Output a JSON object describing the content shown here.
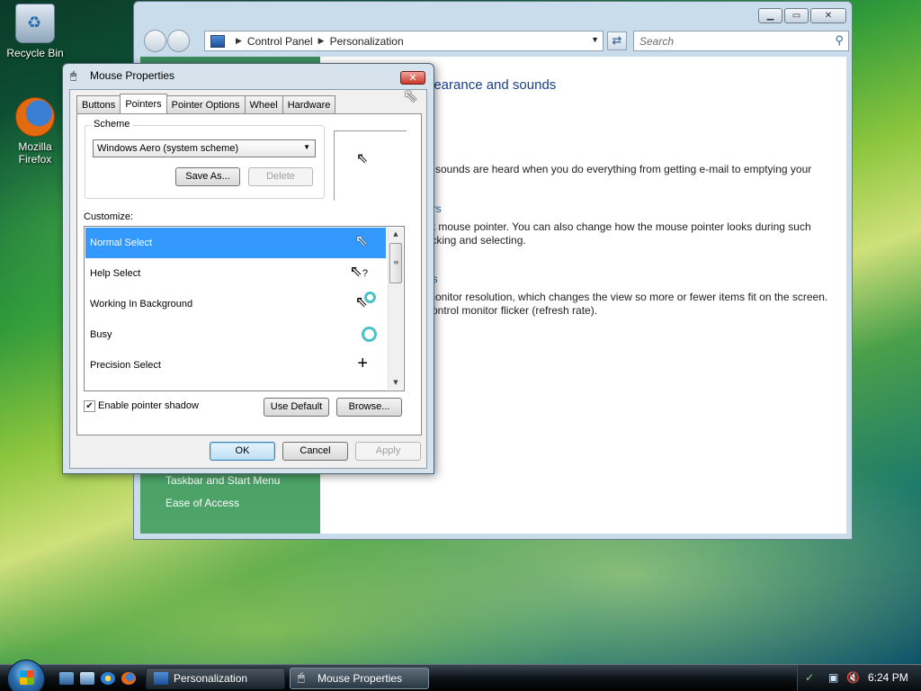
{
  "desktop": {
    "icons": [
      {
        "label": "Recycle Bin"
      },
      {
        "label": "Mozilla Firefox"
      }
    ]
  },
  "control_panel": {
    "address": {
      "segments": [
        "Control Panel",
        "Personalization"
      ]
    },
    "search_placeholder": "Search",
    "heading": "pearance and sounds",
    "lines": [
      "h sounds are heard when you do everything from getting e-mail to emptying your",
      "ers",
      "nt mouse pointer. You can also change how the mouse pointer looks during such",
      "licking and selecting.",
      "gs",
      "monitor resolution, which changes the view so more or fewer items fit on the screen.",
      "control monitor flicker (refresh rate)."
    ],
    "left_links": [
      "Taskbar and Start Menu",
      "Ease of Access"
    ]
  },
  "dialog": {
    "title": "Mouse Properties",
    "tabs": [
      "Buttons",
      "Pointers",
      "Pointer Options",
      "Wheel",
      "Hardware"
    ],
    "active_tab": "Pointers",
    "scheme_label": "Scheme",
    "scheme_value": "Windows Aero (system scheme)",
    "save_as": "Save As...",
    "delete": "Delete",
    "customize_label": "Customize:",
    "cursor_rows": [
      {
        "label": "Normal Select",
        "icon": "arrow-cursor-icon"
      },
      {
        "label": "Help Select",
        "icon": "help-cursor-icon"
      },
      {
        "label": "Working In Background",
        "icon": "working-cursor-icon"
      },
      {
        "label": "Busy",
        "icon": "busy-cursor-icon"
      },
      {
        "label": "Precision Select",
        "icon": "crosshair-cursor-icon"
      }
    ],
    "selected_row": "Normal Select",
    "enable_shadow_label": "Enable pointer shadow",
    "enable_shadow_checked": true,
    "use_default": "Use Default",
    "browse": "Browse...",
    "ok": "OK",
    "cancel": "Cancel",
    "apply": "Apply"
  },
  "taskbar": {
    "tasks": [
      {
        "label": "Personalization",
        "active": false
      },
      {
        "label": "Mouse Properties",
        "active": true
      }
    ],
    "clock": "6:24 PM"
  },
  "colors": {
    "selection": "#3399ff",
    "link": "#1a5fa8",
    "cp_left_pane": "#3d8f5f"
  }
}
